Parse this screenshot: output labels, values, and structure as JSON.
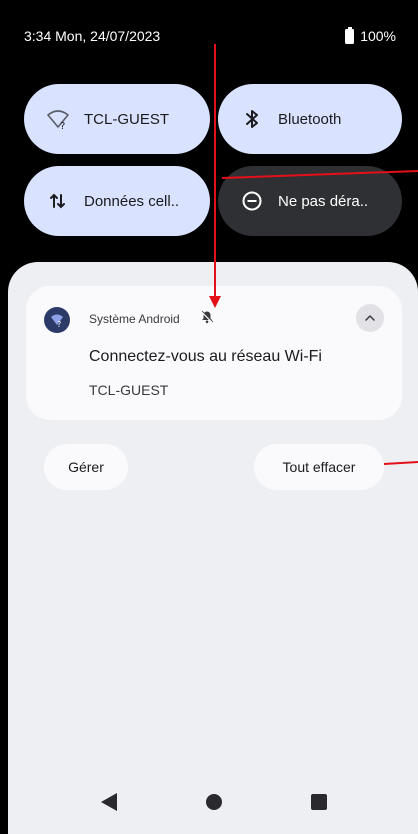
{
  "status_bar": {
    "time": "3:34 Mon, 24/07/2023",
    "battery": "100%"
  },
  "quick_tiles": [
    {
      "label": "TCL-GUEST",
      "icon": "wifi-question-icon",
      "state": "on"
    },
    {
      "label": "Bluetooth",
      "icon": "bluetooth-icon",
      "state": "on"
    },
    {
      "label": "Données cell..",
      "icon": "mobile-data-icon",
      "state": "on"
    },
    {
      "label": "Ne pas déra..",
      "icon": "do-not-disturb-icon",
      "state": "off"
    }
  ],
  "notification": {
    "app_name": "Système Android",
    "title": "Connectez-vous au réseau Wi-Fi",
    "text": "TCL-GUEST"
  },
  "actions": {
    "manage": "Gérer",
    "clear_all": "Tout effacer"
  },
  "colors": {
    "tile_on": "#d9e2ff",
    "tile_off": "#2f3033",
    "annotation": "#e3101a"
  }
}
